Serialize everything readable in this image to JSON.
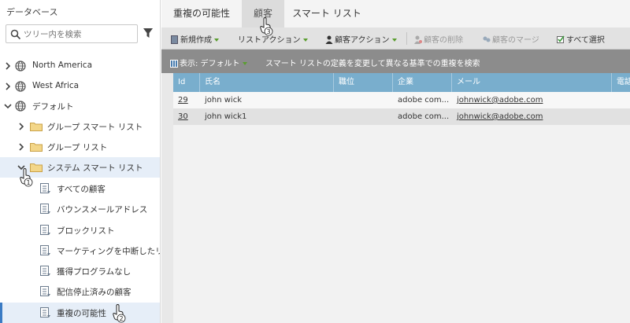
{
  "sidebar": {
    "title": "データベース",
    "search_placeholder": "ツリー内を検索",
    "items": [
      {
        "label": "North America",
        "type": "database"
      },
      {
        "label": "West Africa",
        "type": "database"
      },
      {
        "label": "デフォルト",
        "type": "database"
      },
      {
        "label": "グループ スマート リスト",
        "type": "folder"
      },
      {
        "label": "グループ リスト",
        "type": "folder"
      },
      {
        "label": "システム スマート リスト",
        "type": "folder"
      },
      {
        "label": "すべての顧客",
        "type": "list"
      },
      {
        "label": "バウンスメールアドレス",
        "type": "list"
      },
      {
        "label": "ブロックリスト",
        "type": "list"
      },
      {
        "label": "マーケティングを中断したリード",
        "type": "list"
      },
      {
        "label": "獲得プログラムなし",
        "type": "list"
      },
      {
        "label": "配信停止済みの顧客",
        "type": "list"
      },
      {
        "label": "重複の可能性",
        "type": "list"
      }
    ]
  },
  "tabs": [
    {
      "label": "重複の可能性"
    },
    {
      "label": "顧客"
    },
    {
      "label": "スマート リスト"
    }
  ],
  "toolbar": {
    "new": "新規作成",
    "list_actions": "リストアクション",
    "person_actions": "顧客アクション",
    "delete_person": "顧客の削除",
    "merge_person": "顧客のマージ",
    "select_all": "すべて選択"
  },
  "viewbar": {
    "view_label": "表示: デフォルト",
    "message": "スマート リストの定義を変更して異なる基準での重複を検索"
  },
  "grid": {
    "columns": [
      "Id",
      "氏名",
      "職位",
      "企業",
      "メール",
      "電話"
    ],
    "rows": [
      {
        "id": "29",
        "name": "john wick",
        "title": "",
        "company": "adobe com...",
        "email": "johnwick@adobe.com"
      },
      {
        "id": "30",
        "name": "john wick1",
        "title": "",
        "company": "adobe com...",
        "email": "johnwick@adobe.com"
      }
    ]
  },
  "cursor_badges": {
    "tab_cursor": "3",
    "folder_cursor": "1",
    "item_cursor": "2"
  }
}
